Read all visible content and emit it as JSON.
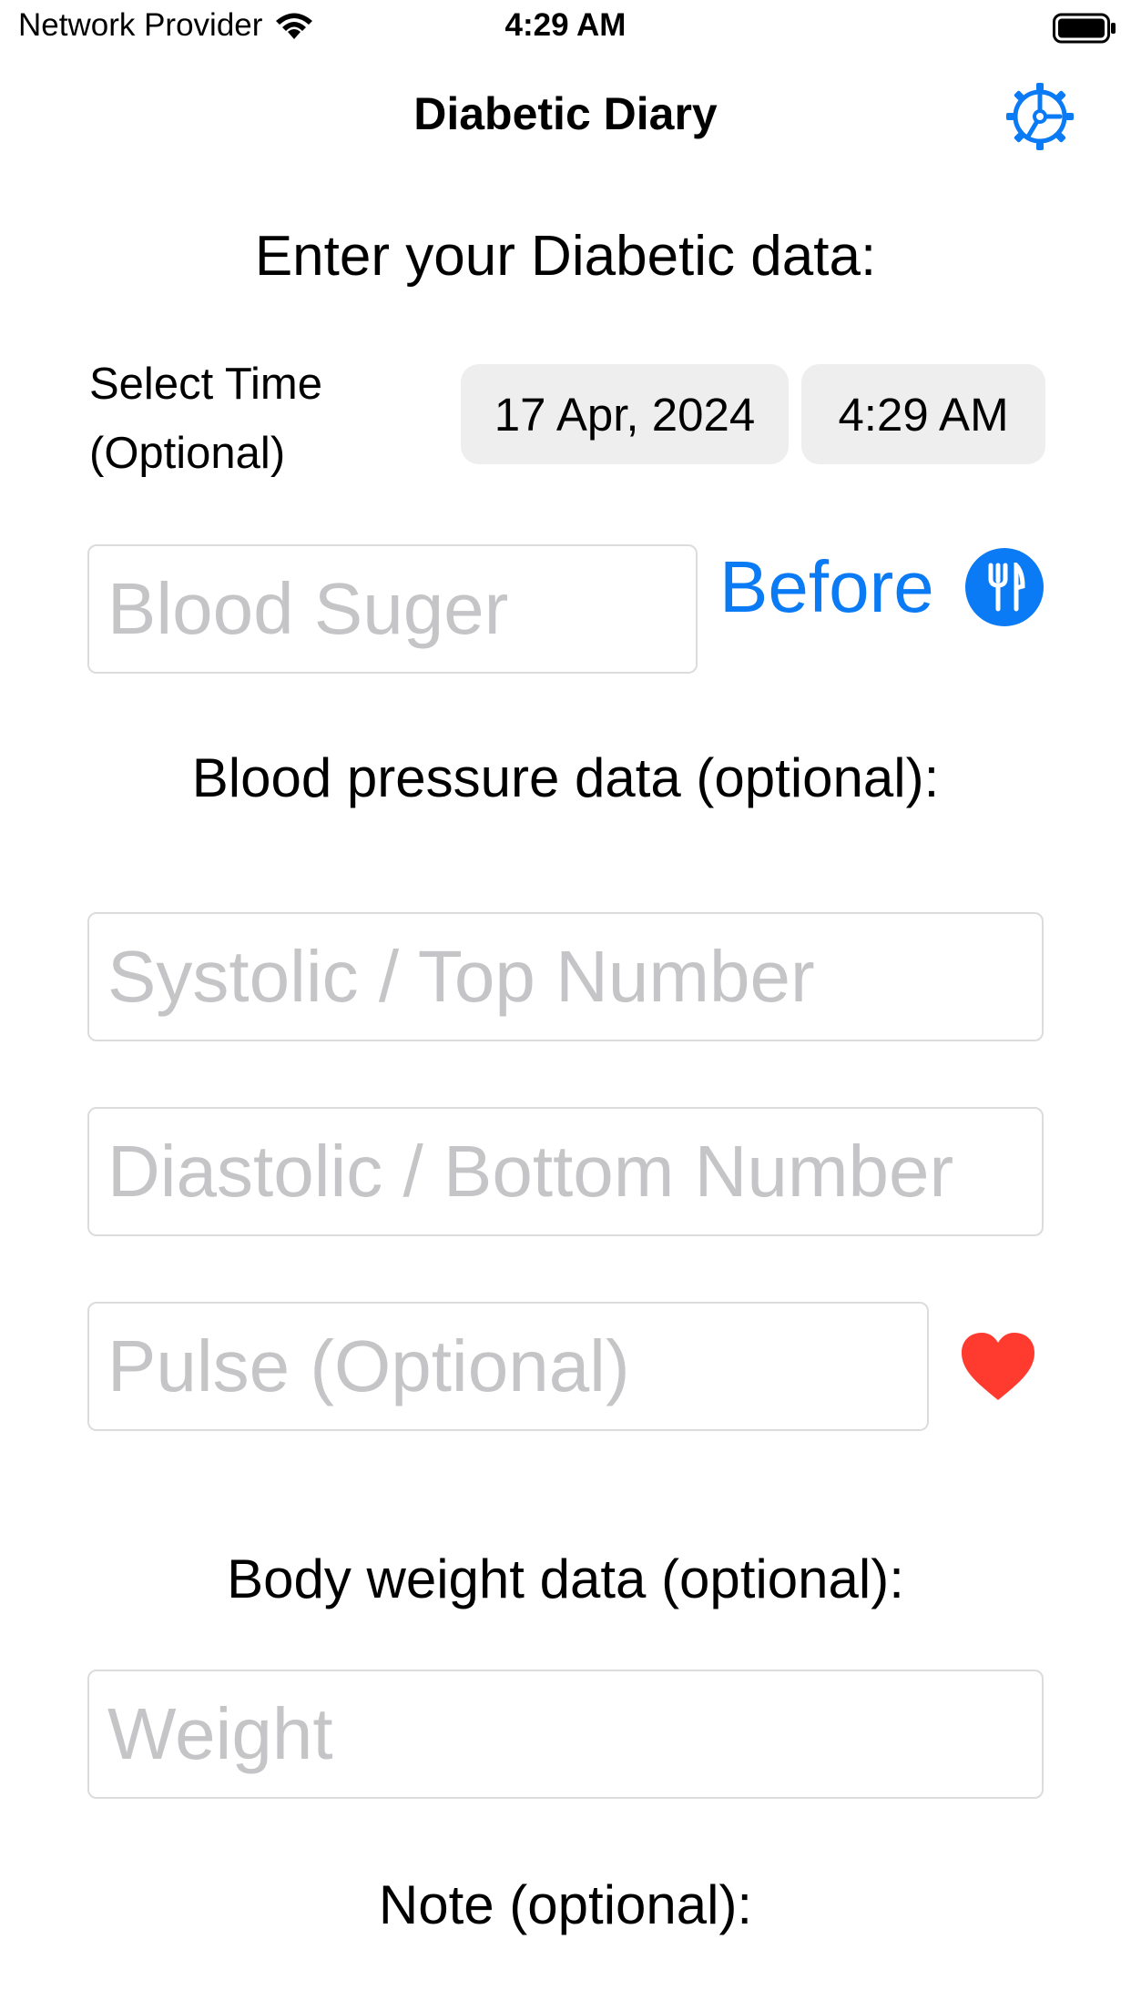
{
  "status_bar": {
    "carrier": "Network Provider",
    "time": "4:29 AM"
  },
  "nav": {
    "title": "Diabetic Diary",
    "settings_icon": "gear-icon"
  },
  "form": {
    "heading": "Enter your Diabetic data:",
    "select_time_label": "Select Time (Optional)",
    "date_value": "17 Apr, 2024",
    "time_value": "4:29 AM",
    "blood_sugar_placeholder": "Blood Suger",
    "meal_toggle_label": "Before",
    "meal_icon": "fork-knife-icon",
    "bp_heading": "Blood pressure data (optional):",
    "systolic_placeholder": "Systolic / Top Number",
    "diastolic_placeholder": "Diastolic / Bottom Number",
    "pulse_placeholder": "Pulse (Optional)",
    "pulse_icon": "heart-icon",
    "weight_heading": "Body weight data (optional):",
    "weight_placeholder": "Weight",
    "note_heading": "Note (optional):"
  },
  "colors": {
    "accent": "#0a7bf5",
    "heart": "#ff3b30",
    "pill_bg": "#eeeeef",
    "placeholder": "#c5c5c7"
  }
}
